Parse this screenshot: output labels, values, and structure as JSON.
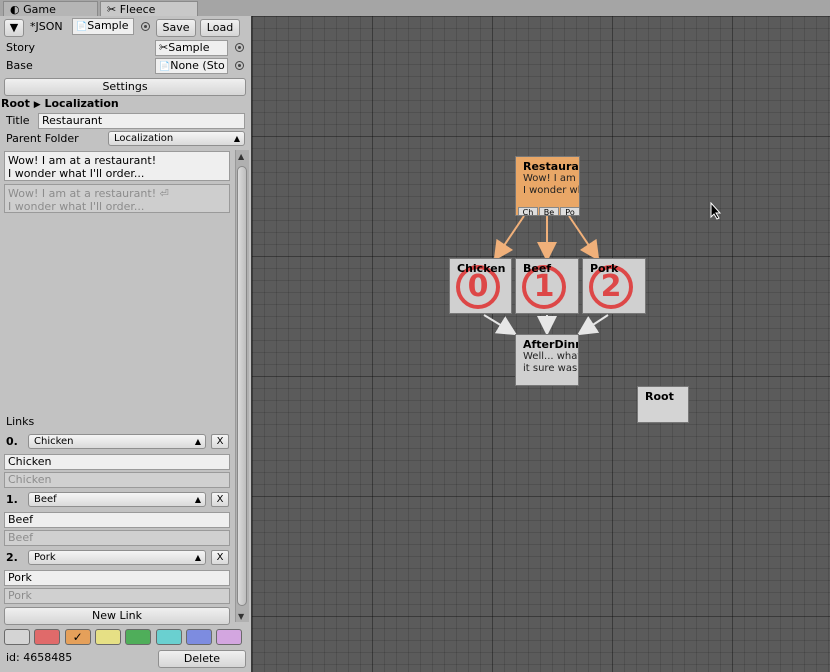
{
  "tabs": [
    {
      "label": "Game",
      "icon": "unity-icon"
    },
    {
      "label": "Fleece Editor",
      "icon": "fleece-icon"
    }
  ],
  "toolbar": {
    "menu_label": "▼",
    "json_label": "*JSON",
    "json_value": "Sample",
    "save_label": "Save",
    "load_label": "Load"
  },
  "story": {
    "label": "Story",
    "value": "Sample"
  },
  "base": {
    "label": "Base",
    "value": "None (Sto"
  },
  "settings_label": "Settings",
  "breadcrumb": {
    "root": "Root",
    "separator": "▶",
    "current": "Localization"
  },
  "title_field": {
    "label": "Title",
    "value": "Restaurant"
  },
  "parent_folder": {
    "label": "Parent Folder",
    "value": "Localization"
  },
  "passage_text": "Wow! I am at a restaurant!\nI wonder what I'll order...",
  "passage_preview": "Wow! I am at a restaurant! ⏎\nI wonder what I'll order...",
  "links": {
    "header": "Links",
    "items": [
      {
        "index": "0.",
        "target": "Chicken",
        "text": "Chicken",
        "preview": "Chicken"
      },
      {
        "index": "1.",
        "target": "Beef",
        "text": "Beef",
        "preview": "Beef"
      },
      {
        "index": "2.",
        "target": "Pork",
        "text": "Pork",
        "preview": "Pork"
      }
    ],
    "remove_label": "X",
    "new_link_label": "New Link"
  },
  "colors": {
    "swatches": [
      "#d4d4d4",
      "#e06a6a",
      "#e5a05a",
      "#e6e085",
      "#4fae5a",
      "#6ad0d0",
      "#7d8ce0",
      "#d3a6e0"
    ],
    "selected_index": 2,
    "selected_mark": "✓"
  },
  "footer": {
    "id_text": "id: 4658485",
    "delete_label": "Delete"
  },
  "graph": {
    "nodes": [
      {
        "key": "restaurant",
        "title": "Restaurant",
        "text": "Wow! I am at a restaurant!\nI wonder what I'll order...",
        "color": "#e9a767",
        "link_tabs": [
          "Ch",
          "Be",
          "Po"
        ]
      },
      {
        "key": "chicken",
        "title": "Chicken",
        "badge": "0",
        "color": "#d0d0d0"
      },
      {
        "key": "beef",
        "title": "Beef",
        "badge": "1",
        "color": "#d0d0d0"
      },
      {
        "key": "pork",
        "title": "Pork",
        "badge": "2",
        "color": "#d0d0d0"
      },
      {
        "key": "afterdinner",
        "title": "AfterDinner",
        "text": "Well... what a meal\nit sure was.",
        "color": "#d0d0d0"
      },
      {
        "key": "root",
        "title": "Root",
        "color": "#d4d4d4"
      }
    ],
    "badge_color": "#e03030",
    "edge_colors": {
      "selected": "#f0b07a",
      "normal": "#e0e0e0"
    }
  }
}
